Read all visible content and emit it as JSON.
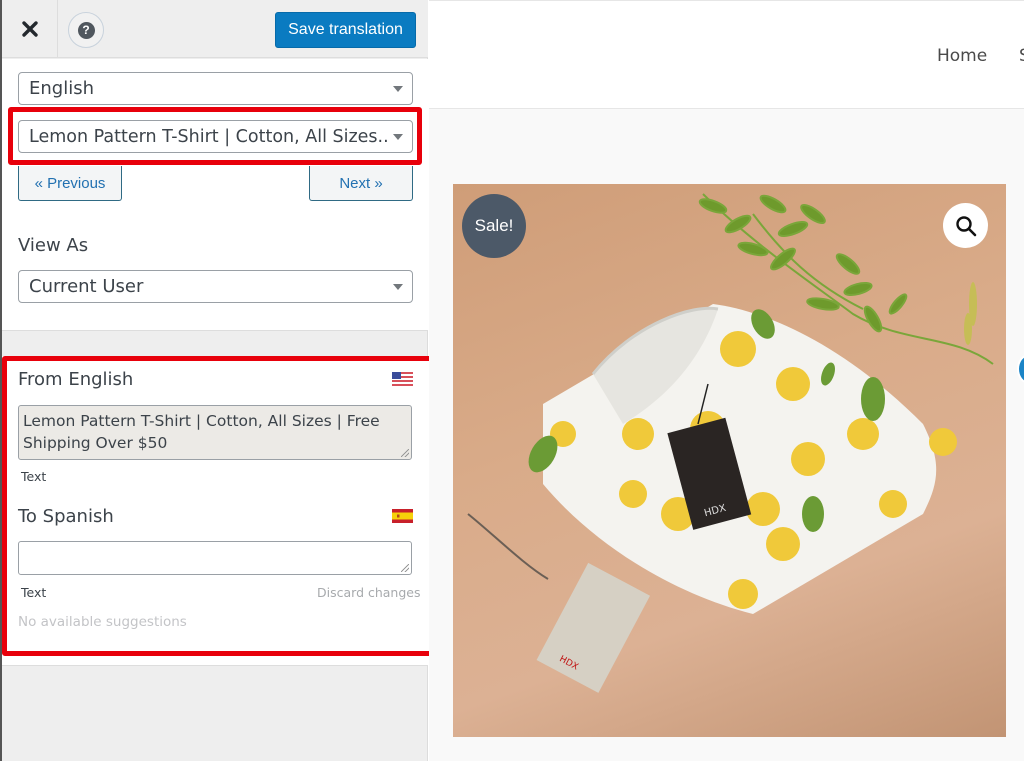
{
  "toolbar": {
    "close_icon": "close-icon",
    "help_icon": "help-icon",
    "help_glyph": "?",
    "save_label": "Save translation"
  },
  "controls": {
    "language_select": {
      "value": "English"
    },
    "string_select": {
      "value": "Lemon Pattern T-Shirt | Cotton, All Sizes..."
    },
    "previous_label": "« Previous",
    "next_label": "Next »",
    "view_as_label": "View As",
    "view_as_select": {
      "value": "Current User"
    }
  },
  "translation": {
    "from": {
      "label": "From English",
      "flag": "us-flag-icon",
      "text": "Lemon Pattern T-Shirt | Cotton, All Sizes | Free Shipping Over $50",
      "type_label": "Text"
    },
    "to": {
      "label": "To Spanish",
      "flag": "spain-flag-icon",
      "text": "",
      "type_label": "Text",
      "discard_label": "Discard changes",
      "suggestions_text": "No available suggestions"
    }
  },
  "preview": {
    "nav": {
      "home": "Home",
      "next_partial": "S"
    },
    "product": {
      "sale_badge": "Sale!",
      "image_alt": "Folded white t-shirt with lemon pattern and hang tags on peach background with green leaves"
    }
  },
  "colors": {
    "primary_button": "#0a7bc1",
    "highlight_red": "#e8000b",
    "sale_badge": "#4c5968",
    "link_blue": "#2271b1"
  }
}
